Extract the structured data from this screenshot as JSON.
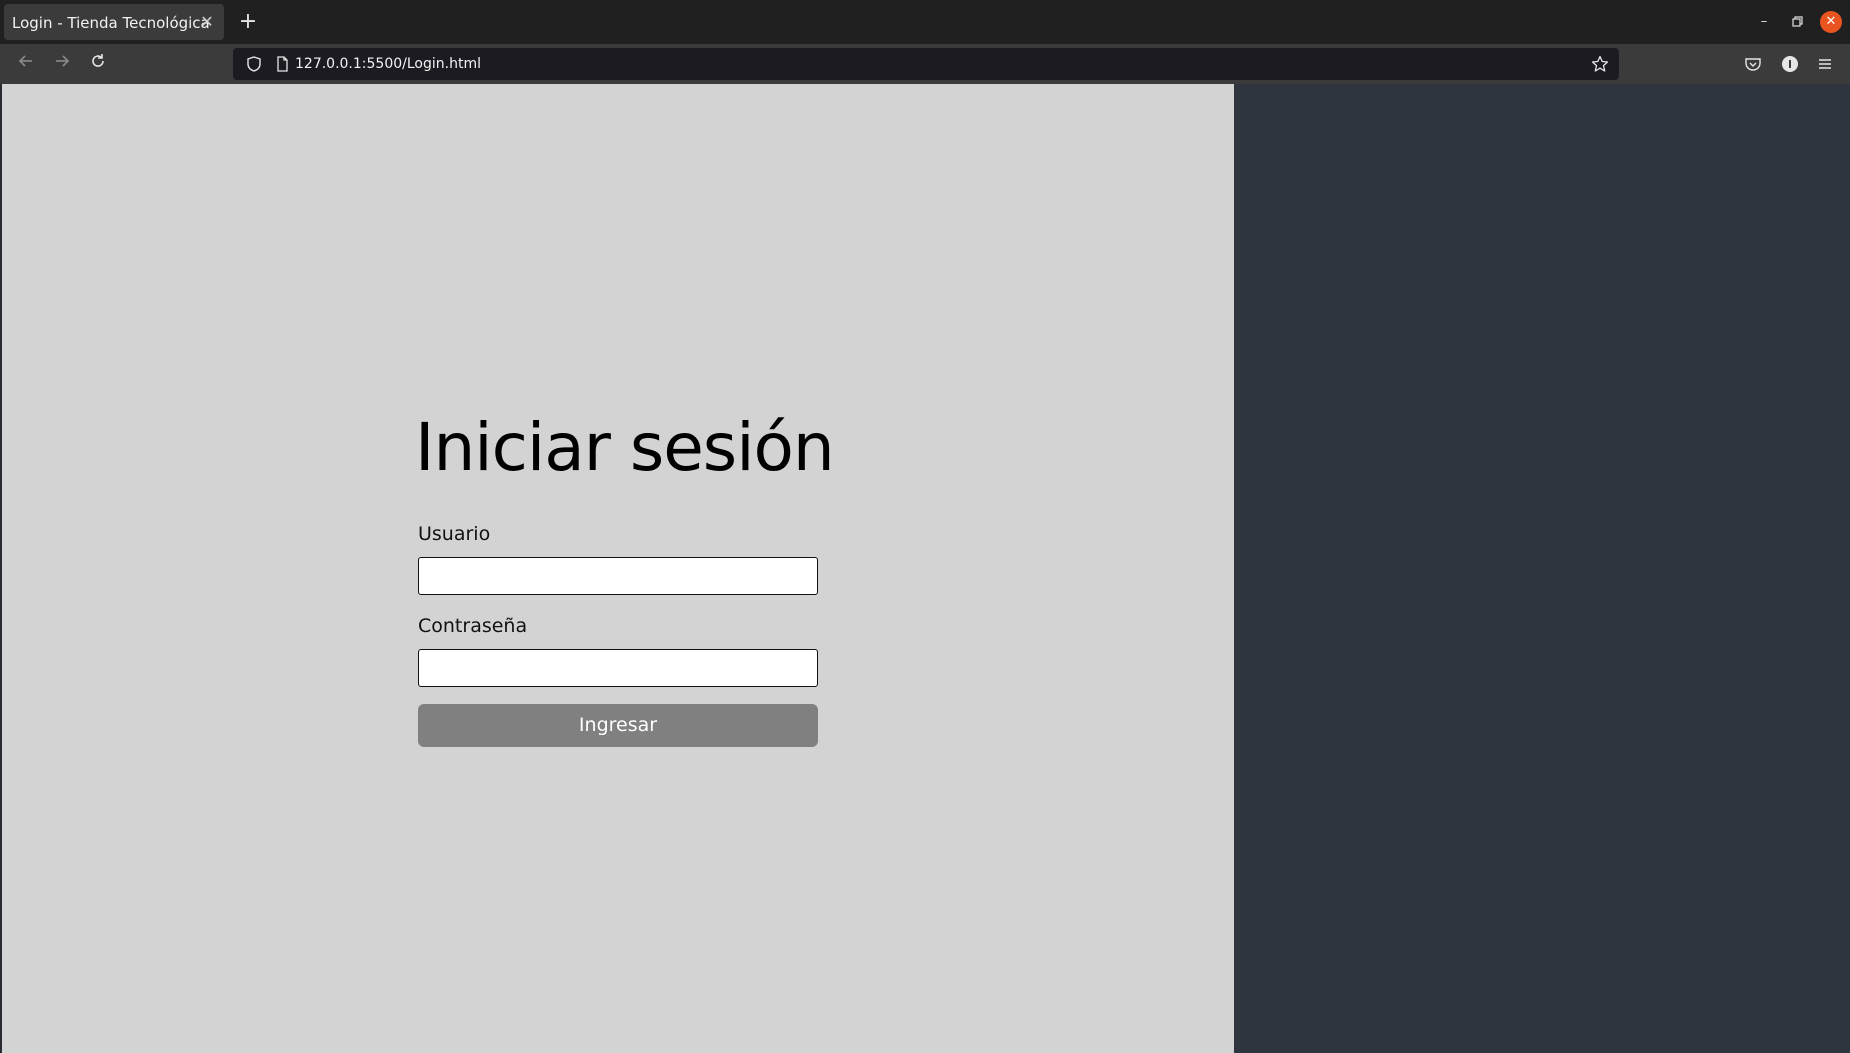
{
  "browser": {
    "tab_title": "Login - Tienda Tecnológica",
    "tab_close_glyph": "✕",
    "new_tab_glyph": "+",
    "url": "127.0.0.1:5500/Login.html",
    "window_controls": {
      "minimize_glyph": "–",
      "maximize_glyph": "▫",
      "close_glyph": "✕"
    },
    "icons": [
      "back-arrow-icon",
      "forward-arrow-icon",
      "reload-icon",
      "shield-icon",
      "page-icon",
      "star-icon",
      "pocket-icon",
      "extension-icon",
      "hamburger-menu-icon"
    ]
  },
  "login": {
    "title": "Iniciar sesión",
    "username_label": "Usuario",
    "username_value": "",
    "password_label": "Contraseña",
    "password_value": "",
    "submit_label": "Ingresar"
  },
  "colors": {
    "left_pane_bg": "#d3d3d3",
    "right_pane_bg": "#2e353e",
    "button_bg": "#808080",
    "button_text": "#ffffff"
  }
}
